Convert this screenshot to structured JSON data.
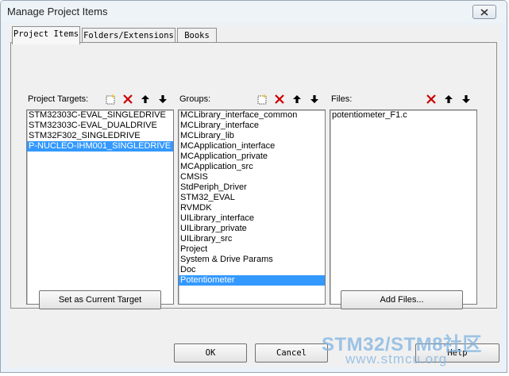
{
  "window": {
    "title": "Manage Project Items"
  },
  "tabs": [
    {
      "label": "Project Items"
    },
    {
      "label": "Folders/Extensions"
    },
    {
      "label": "Books"
    }
  ],
  "targets": {
    "label": "Project Targets:",
    "items": [
      "STM32303C-EVAL_SINGLEDRIVE",
      "STM32303C-EVAL_DUALDRIVE",
      "STM32F302_SINGLEDRIVE",
      "P-NUCLEO-IHM001_SINGLEDRIVE"
    ],
    "selected": 3,
    "button": "Set as Current Target"
  },
  "groups": {
    "label": "Groups:",
    "items": [
      "MCLibrary_interface_common",
      "MCLibrary_interface",
      "MCLibrary_lib",
      "MCApplication_interface",
      "MCApplication_private",
      "MCApplication_src",
      "CMSIS",
      "StdPeriph_Driver",
      "STM32_EVAL",
      "RVMDK",
      "UILibrary_interface",
      "UILibrary_private",
      "UILibrary_src",
      "Project",
      "System & Drive Params",
      "Doc",
      "Potentiometer"
    ],
    "selected": 16
  },
  "files": {
    "label": "Files:",
    "items": [
      "potentiometer_F1.c"
    ],
    "selected": -1,
    "button": "Add Files..."
  },
  "footer": {
    "ok": "OK",
    "cancel": "Cancel",
    "help": "Help"
  },
  "watermark": {
    "line1": "STM32/STM8社区",
    "line2": "www.stmcu.org"
  },
  "colors": {
    "selection": "#3399ff",
    "delete_red": "#cc0000",
    "new_icon_yellow": "#e8c000"
  }
}
